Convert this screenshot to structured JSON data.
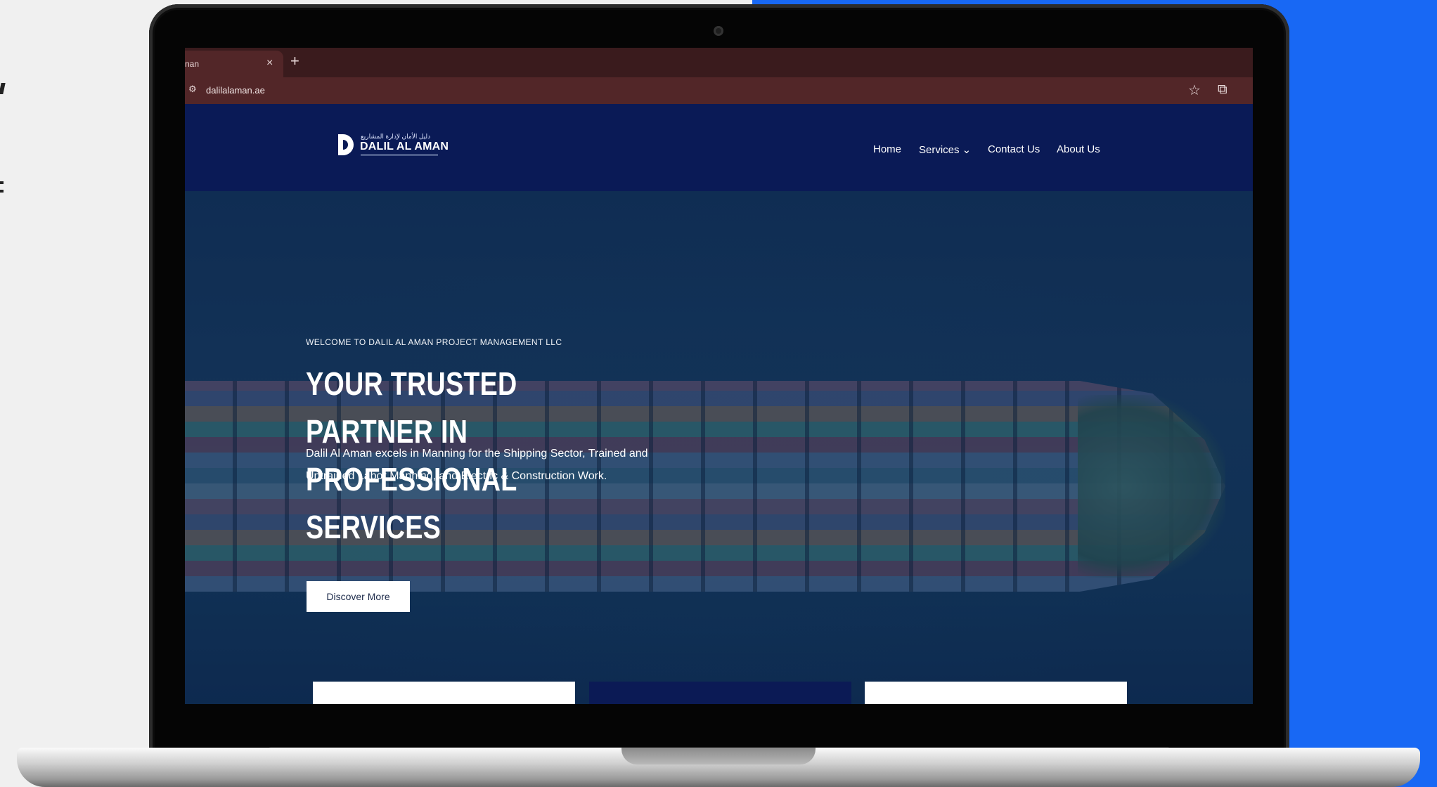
{
  "browser": {
    "tab_title": "nan",
    "tab_close": "×",
    "new_tab": "+",
    "url": "dalilalaman.ae",
    "site_icon": "⚙",
    "bookmark_icon": "☆",
    "extensions_icon": "⧉"
  },
  "site": {
    "logo_text": "DALIL AL AMAN",
    "logo_arabic": "دليل الأمان لإدارة المشاريع",
    "nav": [
      {
        "label": "Home"
      },
      {
        "label": "Services ⌄"
      },
      {
        "label": "Contact Us"
      },
      {
        "label": "About Us"
      }
    ]
  },
  "hero": {
    "kicker": "WELCOME TO DALIL AL AMAN PROJECT MANAGEMENT LLC",
    "title": "YOUR TRUSTED PARTNER IN PROFESSIONAL SERVICES",
    "subtitle": "Dalil Al Aman excels in Manning for the Shipping Sector, Trained and Untrained Labor Manning, and Electric & Construction Work.",
    "button": "Discover More"
  },
  "colors": {
    "background_right": "#1868f4",
    "header": "#0a1a56",
    "browser_chrome": "#522628"
  }
}
